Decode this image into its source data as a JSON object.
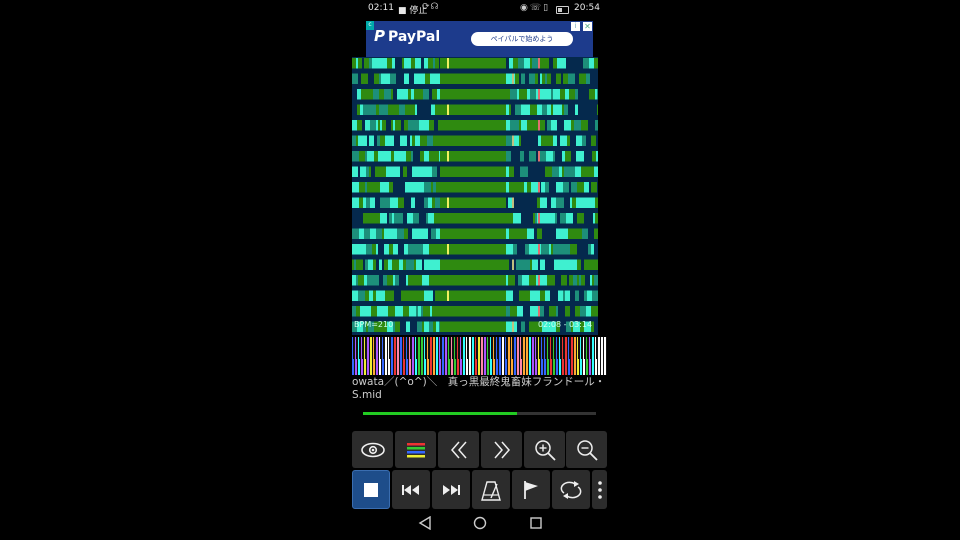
{
  "status_bar": {
    "left_time": "02:11",
    "stop_label": "停止",
    "right_time": "20:54"
  },
  "ad": {
    "brand": "PayPal",
    "cta": "ペイパルで始めよう",
    "info_icon": "info-icon",
    "close_icon": "close-icon"
  },
  "overlay": {
    "bpm": "BPM=210",
    "time": "02:08 - 03:14"
  },
  "song": {
    "title_line1": "owata／(^o^)＼　真っ黒最終鬼畜妹フランドール・",
    "title_line2": "S.mid",
    "progress": 0.66
  },
  "toolbar_top": [
    {
      "name": "eye-button",
      "icon": "eye-icon"
    },
    {
      "name": "tracks-button",
      "icon": "color-bars-icon"
    },
    {
      "name": "rewind-button",
      "icon": "double-chevron-left-icon"
    },
    {
      "name": "forward-button",
      "icon": "double-chevron-right-icon"
    },
    {
      "name": "zoom-in-button",
      "icon": "zoom-in-icon"
    },
    {
      "name": "zoom-out-button",
      "icon": "zoom-out-icon"
    }
  ],
  "toolbar_bottom": [
    {
      "name": "stop-button",
      "icon": "stop-icon"
    },
    {
      "name": "skip-previous-button",
      "icon": "skip-previous-icon"
    },
    {
      "name": "skip-next-button",
      "icon": "skip-next-icon"
    },
    {
      "name": "metronome-button",
      "icon": "metronome-icon"
    },
    {
      "name": "marker-button",
      "icon": "flag-icon"
    },
    {
      "name": "loop-button",
      "icon": "loop-icon"
    },
    {
      "name": "more-button",
      "icon": "more-vertical-icon"
    }
  ],
  "colors": {
    "roll_bg": "#05294d",
    "note_green": "#2f8a10",
    "note_cyan": "#3ff0d0",
    "note_teal": "#1d8f7a",
    "progress": "#22cc22",
    "active_button": "#1e4d8a"
  }
}
